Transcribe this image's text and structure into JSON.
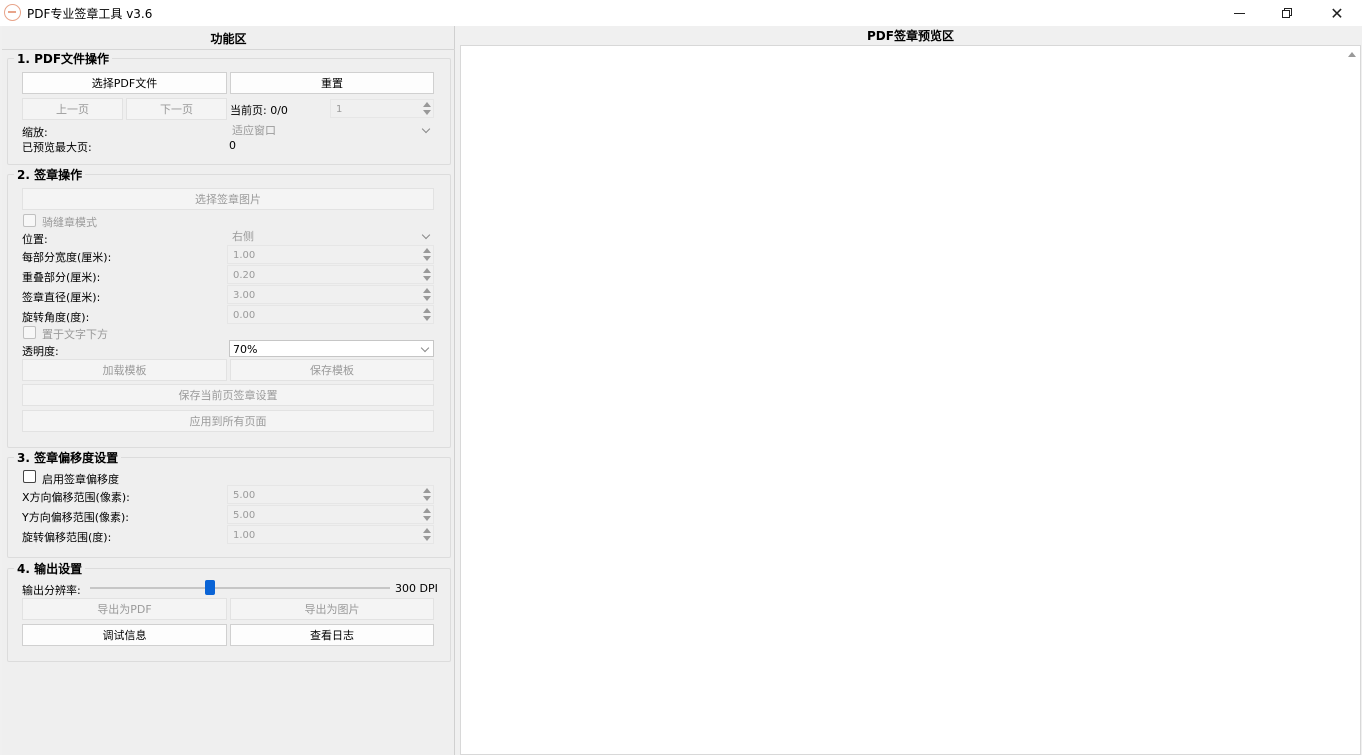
{
  "window": {
    "title": "PDF专业签章工具 v3.6"
  },
  "left": {
    "title": "功能区"
  },
  "group1": {
    "title": "1. PDF文件操作",
    "select_pdf": "选择PDF文件",
    "reset": "重置",
    "prev_page": "上一页",
    "next_page": "下一页",
    "current_page_label": "当前页: 0/0",
    "page_spin_value": "1",
    "zoom_label": "缩放:",
    "zoom_value": "适应窗口",
    "max_preview_label": "已预览最大页:",
    "max_preview_value": "0"
  },
  "group2": {
    "title": "2. 签章操作",
    "select_image": "选择签章图片",
    "seam_mode": "骑缝章模式",
    "position_label": "位置:",
    "position_value": "右侧",
    "part_width_label": "每部分宽度(厘米):",
    "part_width_value": "1.00",
    "overlap_label": "重叠部分(厘米):",
    "overlap_value": "0.20",
    "diameter_label": "签章直径(厘米):",
    "diameter_value": "3.00",
    "rotation_label": "旋转角度(度):",
    "rotation_value": "0.00",
    "below_text": "置于文字下方",
    "opacity_label": "透明度:",
    "opacity_value": "70%",
    "load_template": "加载模板",
    "save_template": "保存模板",
    "save_current": "保存当前页签章设置",
    "apply_all": "应用到所有页面"
  },
  "group3": {
    "title": "3. 签章偏移度设置",
    "enable_offset": "启用签章偏移度",
    "x_range_label": "X方向偏移范围(像素):",
    "x_range_value": "5.00",
    "y_range_label": "Y方向偏移范围(像素):",
    "y_range_value": "5.00",
    "rot_range_label": "旋转偏移范围(度):",
    "rot_range_value": "1.00"
  },
  "group4": {
    "title": "4. 输出设置",
    "resolution_label": "输出分辨率:",
    "resolution_value": "300 DPI",
    "resolution_fraction": 0.4,
    "export_pdf": "导出为PDF",
    "export_image": "导出为图片",
    "debug_info": "调试信息",
    "view_log": "查看日志"
  },
  "preview": {
    "title": "PDF签章预览区"
  },
  "colors": {
    "accent": "#0a64d6",
    "icon": "#e8a48a"
  },
  "icons": {
    "minimize": "minimize-icon",
    "maximize": "restore-icon",
    "close": "close-icon"
  }
}
